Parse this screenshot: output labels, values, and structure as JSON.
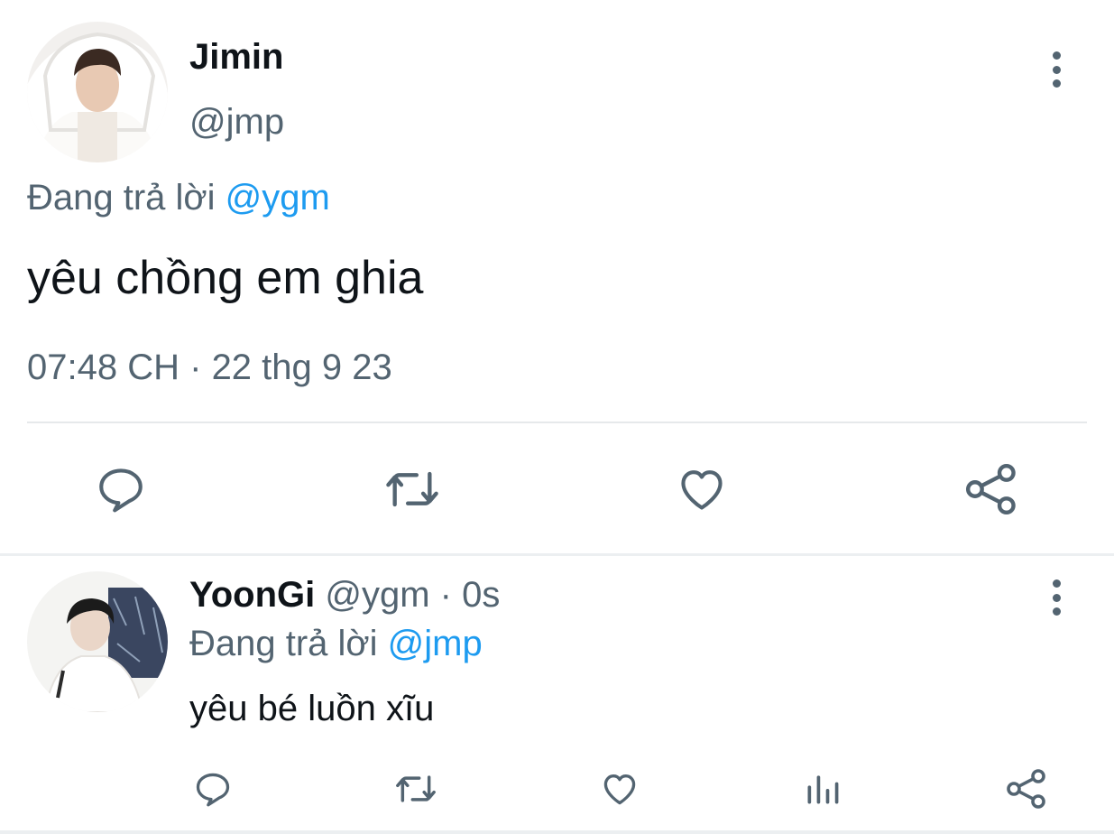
{
  "main_tweet": {
    "display_name": "Jimin",
    "handle": "@jmp",
    "reply_prefix": "Đang trả lời",
    "reply_to": "@ygm",
    "text": "yêu chồng em ghia",
    "time": "07:48 CH",
    "separator": "·",
    "date": "22 thg 9 23",
    "actions": [
      "reply-icon",
      "retweet-icon",
      "like-icon",
      "share-icon"
    ]
  },
  "reply_tweet": {
    "display_name": "YoonGi",
    "handle": "@ygm",
    "separator": "·",
    "age": "0s",
    "reply_prefix": "Đang trả lời",
    "reply_to": "@jmp",
    "text": "yêu bé luồn xĩu",
    "actions": [
      "reply-icon",
      "retweet-icon",
      "like-icon",
      "views-icon",
      "share-icon"
    ]
  },
  "colors": {
    "text_primary": "#0f1419",
    "text_secondary": "#536471",
    "accent": "#1d9bf0",
    "divider": "#e6e9eb"
  }
}
